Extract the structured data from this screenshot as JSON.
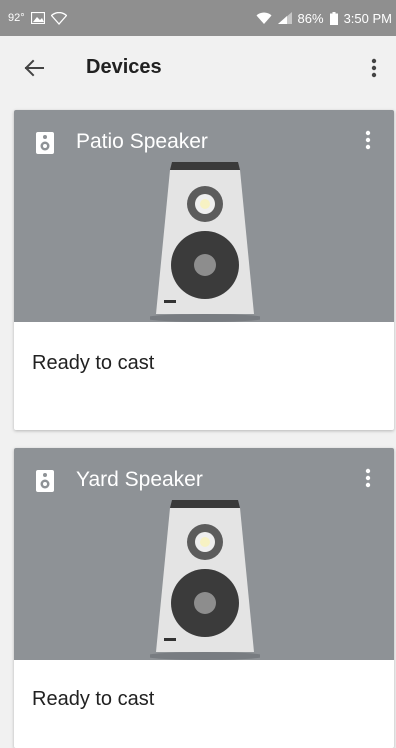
{
  "status_bar": {
    "temperature": "92°",
    "battery": "86%",
    "time": "3:50 PM"
  },
  "header": {
    "title": "Devices"
  },
  "devices": [
    {
      "name": "Patio Speaker",
      "status": "Ready to cast"
    },
    {
      "name": "Yard Speaker",
      "status": "Ready to cast"
    }
  ],
  "colors": {
    "status_bar": "#8f8f8f",
    "card_hero": "#8e9296",
    "background": "#f1f1f1"
  }
}
